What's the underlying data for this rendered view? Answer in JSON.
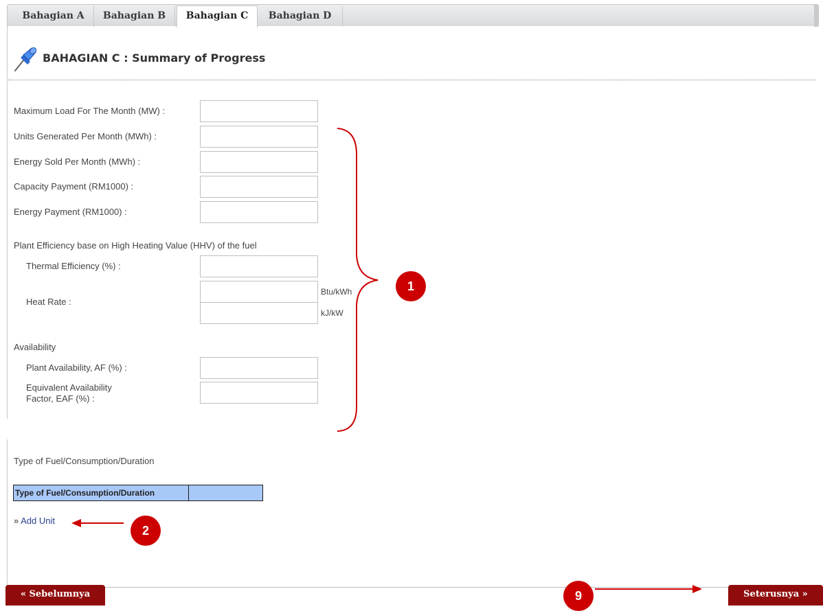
{
  "tabs": [
    {
      "label": "Bahagian A",
      "active": false
    },
    {
      "label": "Bahagian B",
      "active": false
    },
    {
      "label": "Bahagian C",
      "active": true
    },
    {
      "label": "Bahagian D",
      "active": false
    }
  ],
  "header": {
    "title": "BAHAGIAN C : Summary of Progress",
    "icon": "pushpin-icon"
  },
  "form": {
    "max_load": {
      "label": "Maximum Load For The Month (MW) :",
      "value": ""
    },
    "units_generated": {
      "label": "Units Generated Per Month (MWh) :",
      "value": ""
    },
    "energy_sold": {
      "label": "Energy Sold Per Month (MWh) :",
      "value": ""
    },
    "capacity_payment": {
      "label": "Capacity Payment (RM1000) :",
      "value": ""
    },
    "energy_payment": {
      "label": "Energy Payment (RM1000) :",
      "value": ""
    },
    "efficiency_section": "Plant Efficiency base on High Heating Value (HHV) of the fuel",
    "thermal_efficiency": {
      "label": "Thermal Efficiency (%) :",
      "value": ""
    },
    "heat_rate": {
      "label": "Heat Rate :",
      "value_btu": "",
      "value_kj": "",
      "unit_btu": "Btu/kWh",
      "unit_kj": "kJ/kW"
    },
    "availability_section": "Availability",
    "plant_availability": {
      "label": "Plant Availability, AF (%) :",
      "value": ""
    },
    "eaf": {
      "label_line1": "Equivalent Availability",
      "label_line2": "Factor, EAF (%) :",
      "value": ""
    }
  },
  "fuel": {
    "section_label": "Type of Fuel/Consumption/Duration",
    "table_header": "Type of Fuel/Consumption/Duration",
    "add_unit_prefix": "»",
    "add_unit_label": "Add Unit"
  },
  "nav": {
    "prev_label": "« Sebelumnya",
    "next_label": "Seterusnya »"
  },
  "annotations": {
    "badge_1": "1",
    "badge_2": "2",
    "badge_9": "9",
    "color": "#cc0000"
  }
}
